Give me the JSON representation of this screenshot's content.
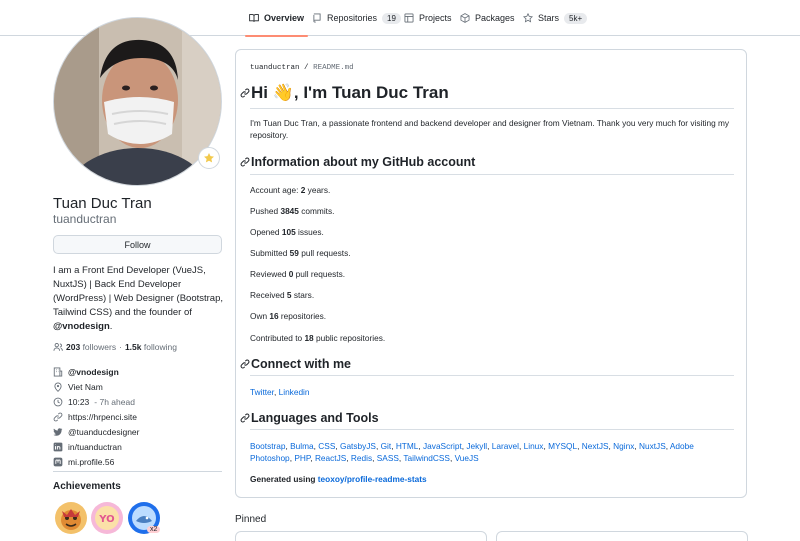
{
  "nav": {
    "tabs": [
      {
        "label": "Overview",
        "icon": "book-icon"
      },
      {
        "label": "Repositories",
        "icon": "repo-icon",
        "count": "19"
      },
      {
        "label": "Projects",
        "icon": "table-icon"
      },
      {
        "label": "Packages",
        "icon": "package-icon"
      },
      {
        "label": "Stars",
        "icon": "star-icon",
        "count": "5k+"
      }
    ]
  },
  "profile": {
    "fullname": "Tuan Duc Tran",
    "login": "tuanductran",
    "follow_label": "Follow",
    "bio_text": "I am a Front End Developer (VueJS, NuxtJS) | Back End Developer (WordPress) | Web Designer (Bootstrap, Tailwind CSS) and the founder of",
    "bio_org": "@vnodesign",
    "bio_end": ".",
    "followers_count": "203",
    "followers_label": "followers",
    "separator": "·",
    "following_count": "1.5k",
    "following_label": "following",
    "details": {
      "org": "@vnodesign",
      "location": "Viet Nam",
      "time": "10:23",
      "time_suffix": "- 7h ahead",
      "website": "https://hrpenci.site",
      "twitter": "@tuanducdesigner",
      "linkedin": "in/tuanductran",
      "mastodon": "mi.profile.56"
    },
    "achievements_title": "Achievements",
    "achievement_multiplier": "x2"
  },
  "readme": {
    "crumb_user": "tuanductran",
    "crumb_sep": "/",
    "crumb_file": "README.md",
    "title": "Hi 👋, I'm Tuan Duc Tran",
    "intro": "I'm Tuan Duc Tran, a passionate frontend and backend developer and designer from Vietnam. Thank you very much for visiting my repository.",
    "info_title": "Information about my GitHub account",
    "stats": [
      {
        "pre": "Account age: ",
        "val": "2",
        "post": " years."
      },
      {
        "pre": "Pushed ",
        "val": "3845",
        "post": " commits."
      },
      {
        "pre": "Opened ",
        "val": "105",
        "post": " issues."
      },
      {
        "pre": "Submitted ",
        "val": "59",
        "post": " pull requests."
      },
      {
        "pre": "Reviewed ",
        "val": "0",
        "post": " pull requests."
      },
      {
        "pre": "Received ",
        "val": "5",
        "post": " stars."
      },
      {
        "pre": "Own ",
        "val": "16",
        "post": " repositories."
      },
      {
        "pre": "Contributed to ",
        "val": "18",
        "post": " public repositories."
      }
    ],
    "connect_title": "Connect with me",
    "connect_links": [
      "Twitter",
      "Linkedin"
    ],
    "tools_title": "Languages and Tools",
    "tools": [
      "Bootstrap",
      "Bulma",
      "CSS",
      "GatsbyJS",
      "Git",
      "HTML",
      "JavaScript",
      "Jekyll",
      "Laravel",
      "Linux",
      "MYSQL",
      "NextJS",
      "Nginx",
      "NuxtJS",
      "Adobe Photoshop",
      "PHP",
      "ReactJS",
      "Redis",
      "SASS",
      "TailwindCSS",
      "VueJS"
    ],
    "generated_label": "Generated using",
    "generated_link": "teoxoy/profile-readme-stats"
  },
  "pinned_title": "Pinned",
  "colors": {
    "accent": "#0969da",
    "tab_underline": "#fd8c73",
    "border": "#d0d7de"
  }
}
